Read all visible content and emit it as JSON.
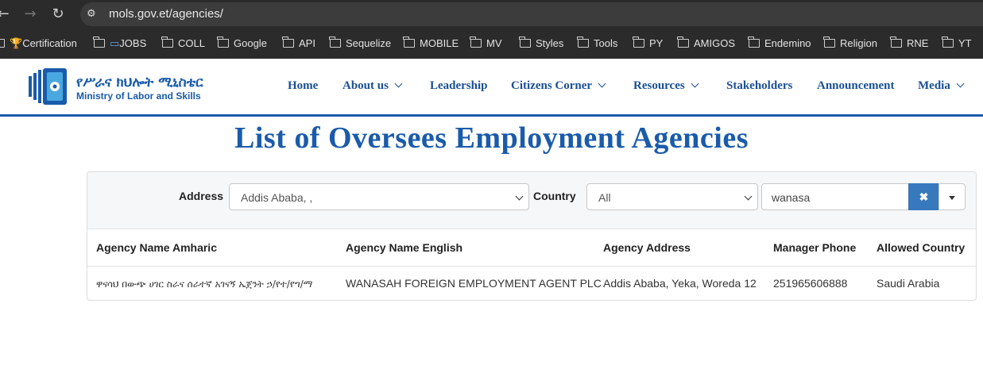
{
  "browser": {
    "url": "mols.gov.et/agencies/",
    "bookmarks": [
      "Certification",
      "JOBS",
      "COLL",
      "Google",
      "API",
      "Sequelize",
      "MOBILE",
      "MV",
      "Styles",
      "Tools",
      "PY",
      "AMIGOS",
      "Endemino",
      "Religion",
      "RNE",
      "YT"
    ]
  },
  "site": {
    "logo_amharic": "የሥራና ክህሎት ሚኒስቴር",
    "logo_english": "Ministry of Labor and Skills",
    "nav": [
      {
        "label": "Home",
        "dropdown": false
      },
      {
        "label": "About us",
        "dropdown": true
      },
      {
        "label": "Leadership",
        "dropdown": false
      },
      {
        "label": "Citizens Corner",
        "dropdown": true
      },
      {
        "label": "Resources",
        "dropdown": true
      },
      {
        "label": "Stakeholders",
        "dropdown": false
      },
      {
        "label": "Announcement",
        "dropdown": false
      },
      {
        "label": "Media",
        "dropdown": true
      }
    ]
  },
  "page": {
    "title": "List of Oversees Employment Agencies"
  },
  "filters": {
    "address_label": "Address",
    "address_value": "Addis Ababa, ,",
    "country_label": "Country",
    "country_value": "All",
    "search_value": "wanasa",
    "clear_symbol": "✖"
  },
  "table": {
    "columns": [
      "Agency Name Amharic",
      "Agency Name English",
      "Agency Address",
      "Manager Phone",
      "Allowed Country"
    ],
    "rows": [
      [
        "ዋናሳህ በውጭ ሀገር ስራና ሰራተኛ አገናኝ ኤጀንት ኃ/የተ/የግ/ማ",
        "WANASAH FOREIGN EMPLOYMENT AGENT PLC",
        "Addis Ababa, Yeka, Woreda 12",
        "251965606888",
        "Saudi Arabia"
      ]
    ]
  },
  "colors": {
    "brand": "#1a5bab",
    "button": "#3779bd",
    "chrome": "#2b2b2b"
  }
}
